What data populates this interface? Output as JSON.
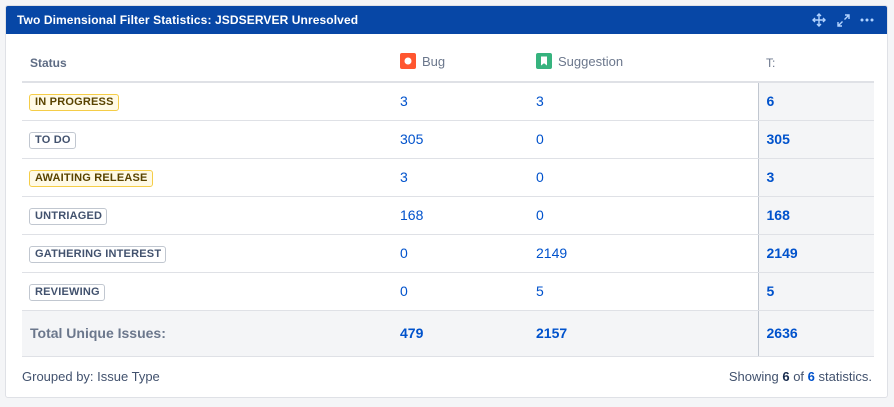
{
  "gadget": {
    "title": "Two Dimensional Filter Statistics: JSDSERVER Unresolved"
  },
  "icons": {
    "move": "move-icon",
    "maximize": "maximize-icon",
    "more": "more-icon",
    "bug": "bug-type-icon",
    "suggestion": "suggestion-type-icon"
  },
  "colors": {
    "header_bg": "#0747a6",
    "link": "#0052cc",
    "bug": "#ff5630",
    "suggestion": "#36b37e"
  },
  "table": {
    "headers": {
      "status": "Status",
      "bug": "Bug",
      "suggestion": "Suggestion",
      "total": "T:"
    },
    "rows": [
      {
        "status": "IN PROGRESS",
        "bug": "3",
        "suggestion": "3",
        "total": "6"
      },
      {
        "status": "TO DO",
        "bug": "305",
        "suggestion": "0",
        "total": "305"
      },
      {
        "status": "AWAITING RELEASE",
        "bug": "3",
        "suggestion": "0",
        "total": "3"
      },
      {
        "status": "UNTRIAGED",
        "bug": "168",
        "suggestion": "0",
        "total": "168"
      },
      {
        "status": "GATHERING INTEREST",
        "bug": "0",
        "suggestion": "2149",
        "total": "2149"
      },
      {
        "status": "REVIEWING",
        "bug": "0",
        "suggestion": "5",
        "total": "5"
      }
    ],
    "totals": {
      "label": "Total Unique Issues:",
      "bug": "479",
      "suggestion": "2157",
      "total": "2636"
    }
  },
  "footer": {
    "grouped_by": "Grouped by: Issue Type",
    "showing_prefix": "Showing",
    "shown": "6",
    "of_text": "of",
    "total": "6",
    "suffix": "statistics."
  }
}
